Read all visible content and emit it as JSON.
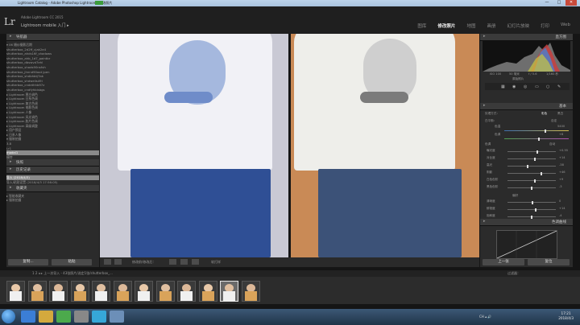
{
  "window": {
    "title": "Lightroom Catalog - Adobe Photoshop Lightroom - 修改照片",
    "controls": [
      "—",
      "□",
      "✕"
    ]
  },
  "header": {
    "logo": "Lr",
    "identity_line1": "Adobe Lightroom CC 2015",
    "identity_line2": "Lightroom mobile 入门 ▸",
    "modules": [
      {
        "label": "图库",
        "active": false
      },
      {
        "label": "修改照片",
        "active": true
      },
      {
        "label": "地图",
        "active": false
      },
      {
        "label": "画册",
        "active": false
      },
      {
        "label": "幻灯片放映",
        "active": false
      },
      {
        "label": "打印",
        "active": false
      },
      {
        "label": "Web",
        "active": false
      }
    ]
  },
  "left_panel": {
    "navigator_header": "导航器",
    "tree_items": [
      "▾ 06 婚纱摄影后期",
      "   shutterbox_2d2ff_cjak2e4",
      "   shutterbox_ahds16f_shadows",
      "   shutterbox_ahb_1d7_paintbr",
      "   shutterbox_dbswvd7ehl",
      "   shutterbox_shads90nsfvh",
      "   shutterbox_jhnnd90oot jpen",
      "   shutterbox_shdbhbtj7ak",
      "   shutterbox_shdwelis49i",
      "   shutterbox_cndethhb97z",
      "   shutterbox_cndfyhbisbgs",
      "▸ Lightroom 黑白调色",
      "▸ Lightroom 日系色调",
      "▸ Lightroom 复古色调",
      "▸ Lightroom 电影色调",
      "▸ Lightroom 人像",
      "▸ Lightroom 风光调色",
      "▸ Lightroom 胶片色调",
      "▸ Lightroom 高级调整",
      "▸ 用户预设",
      "▸ 日系人像",
      "▾ 服装拍摄",
      "   3.8",
      "   Lr1",
      "   modal1",
      "   模特"
    ],
    "selected_item": 24,
    "snapshots_header": "快照",
    "history_header": "历史记录",
    "history_items": [
      "导入 (2018/4/3)",
      "导入/粘贴设置 (2018/4/3 17:56:05)"
    ],
    "collections_header": "收藏夹",
    "collection_items": [
      "▸ 智能收藏夹",
      "▸ 服装拍摄"
    ],
    "copy_button": "复制...",
    "paste_button": "粘贴"
  },
  "toolbar": {
    "before_after_label": "修改前/修改后：",
    "softproof_label": "软打样"
  },
  "right_panel": {
    "histogram_header": "直方图",
    "histogram_readout": [
      "ISO 100",
      "50 毫米",
      "f / 5.6",
      "1/160 秒"
    ],
    "original_photo": "原始照片",
    "basic_header": "基本",
    "treatment_label": "处理方式：",
    "treatment_color": "彩色",
    "treatment_bw": "黑白",
    "wb_label": "白平衡：",
    "wb_value": "自定",
    "temp_label": "色温",
    "temp_value": "5400",
    "tint_label": "色调",
    "tint_value": "+8",
    "tone_label": "色调",
    "auto_label": "自动",
    "sliders": [
      {
        "label": "曝光度",
        "value": "+0.55",
        "pos": 0.6
      },
      {
        "label": "对比度",
        "value": "+14",
        "pos": 0.55
      },
      {
        "label": "高光",
        "value": "-38",
        "pos": 0.4
      },
      {
        "label": "阴影",
        "value": "+46",
        "pos": 0.68
      },
      {
        "label": "白色色阶",
        "value": "+9",
        "pos": 0.55
      },
      {
        "label": "黑色色阶",
        "value": "-3",
        "pos": 0.49
      }
    ],
    "presence_label": "偏好",
    "presence_sliders": [
      {
        "label": "清晰度",
        "value": "0",
        "pos": 0.5
      },
      {
        "label": "鲜艳度",
        "value": "+14",
        "pos": 0.56
      },
      {
        "label": "饱和度",
        "value": "-4",
        "pos": 0.48
      }
    ],
    "curve_header": "色调曲线",
    "prev_button": "上一张",
    "reset_button": "复位"
  },
  "filmstrip": {
    "bar_text": "1 2 ◂ ▸  上一次导入 - 43张照片/选定1张/shutterbox_...",
    "filter_label": "过滤器：",
    "thumb_count": 12,
    "selected_index": 10
  },
  "taskbar": {
    "time": "17:21",
    "date": "2018/4/3",
    "tray": "CH ▴ 🔊"
  }
}
